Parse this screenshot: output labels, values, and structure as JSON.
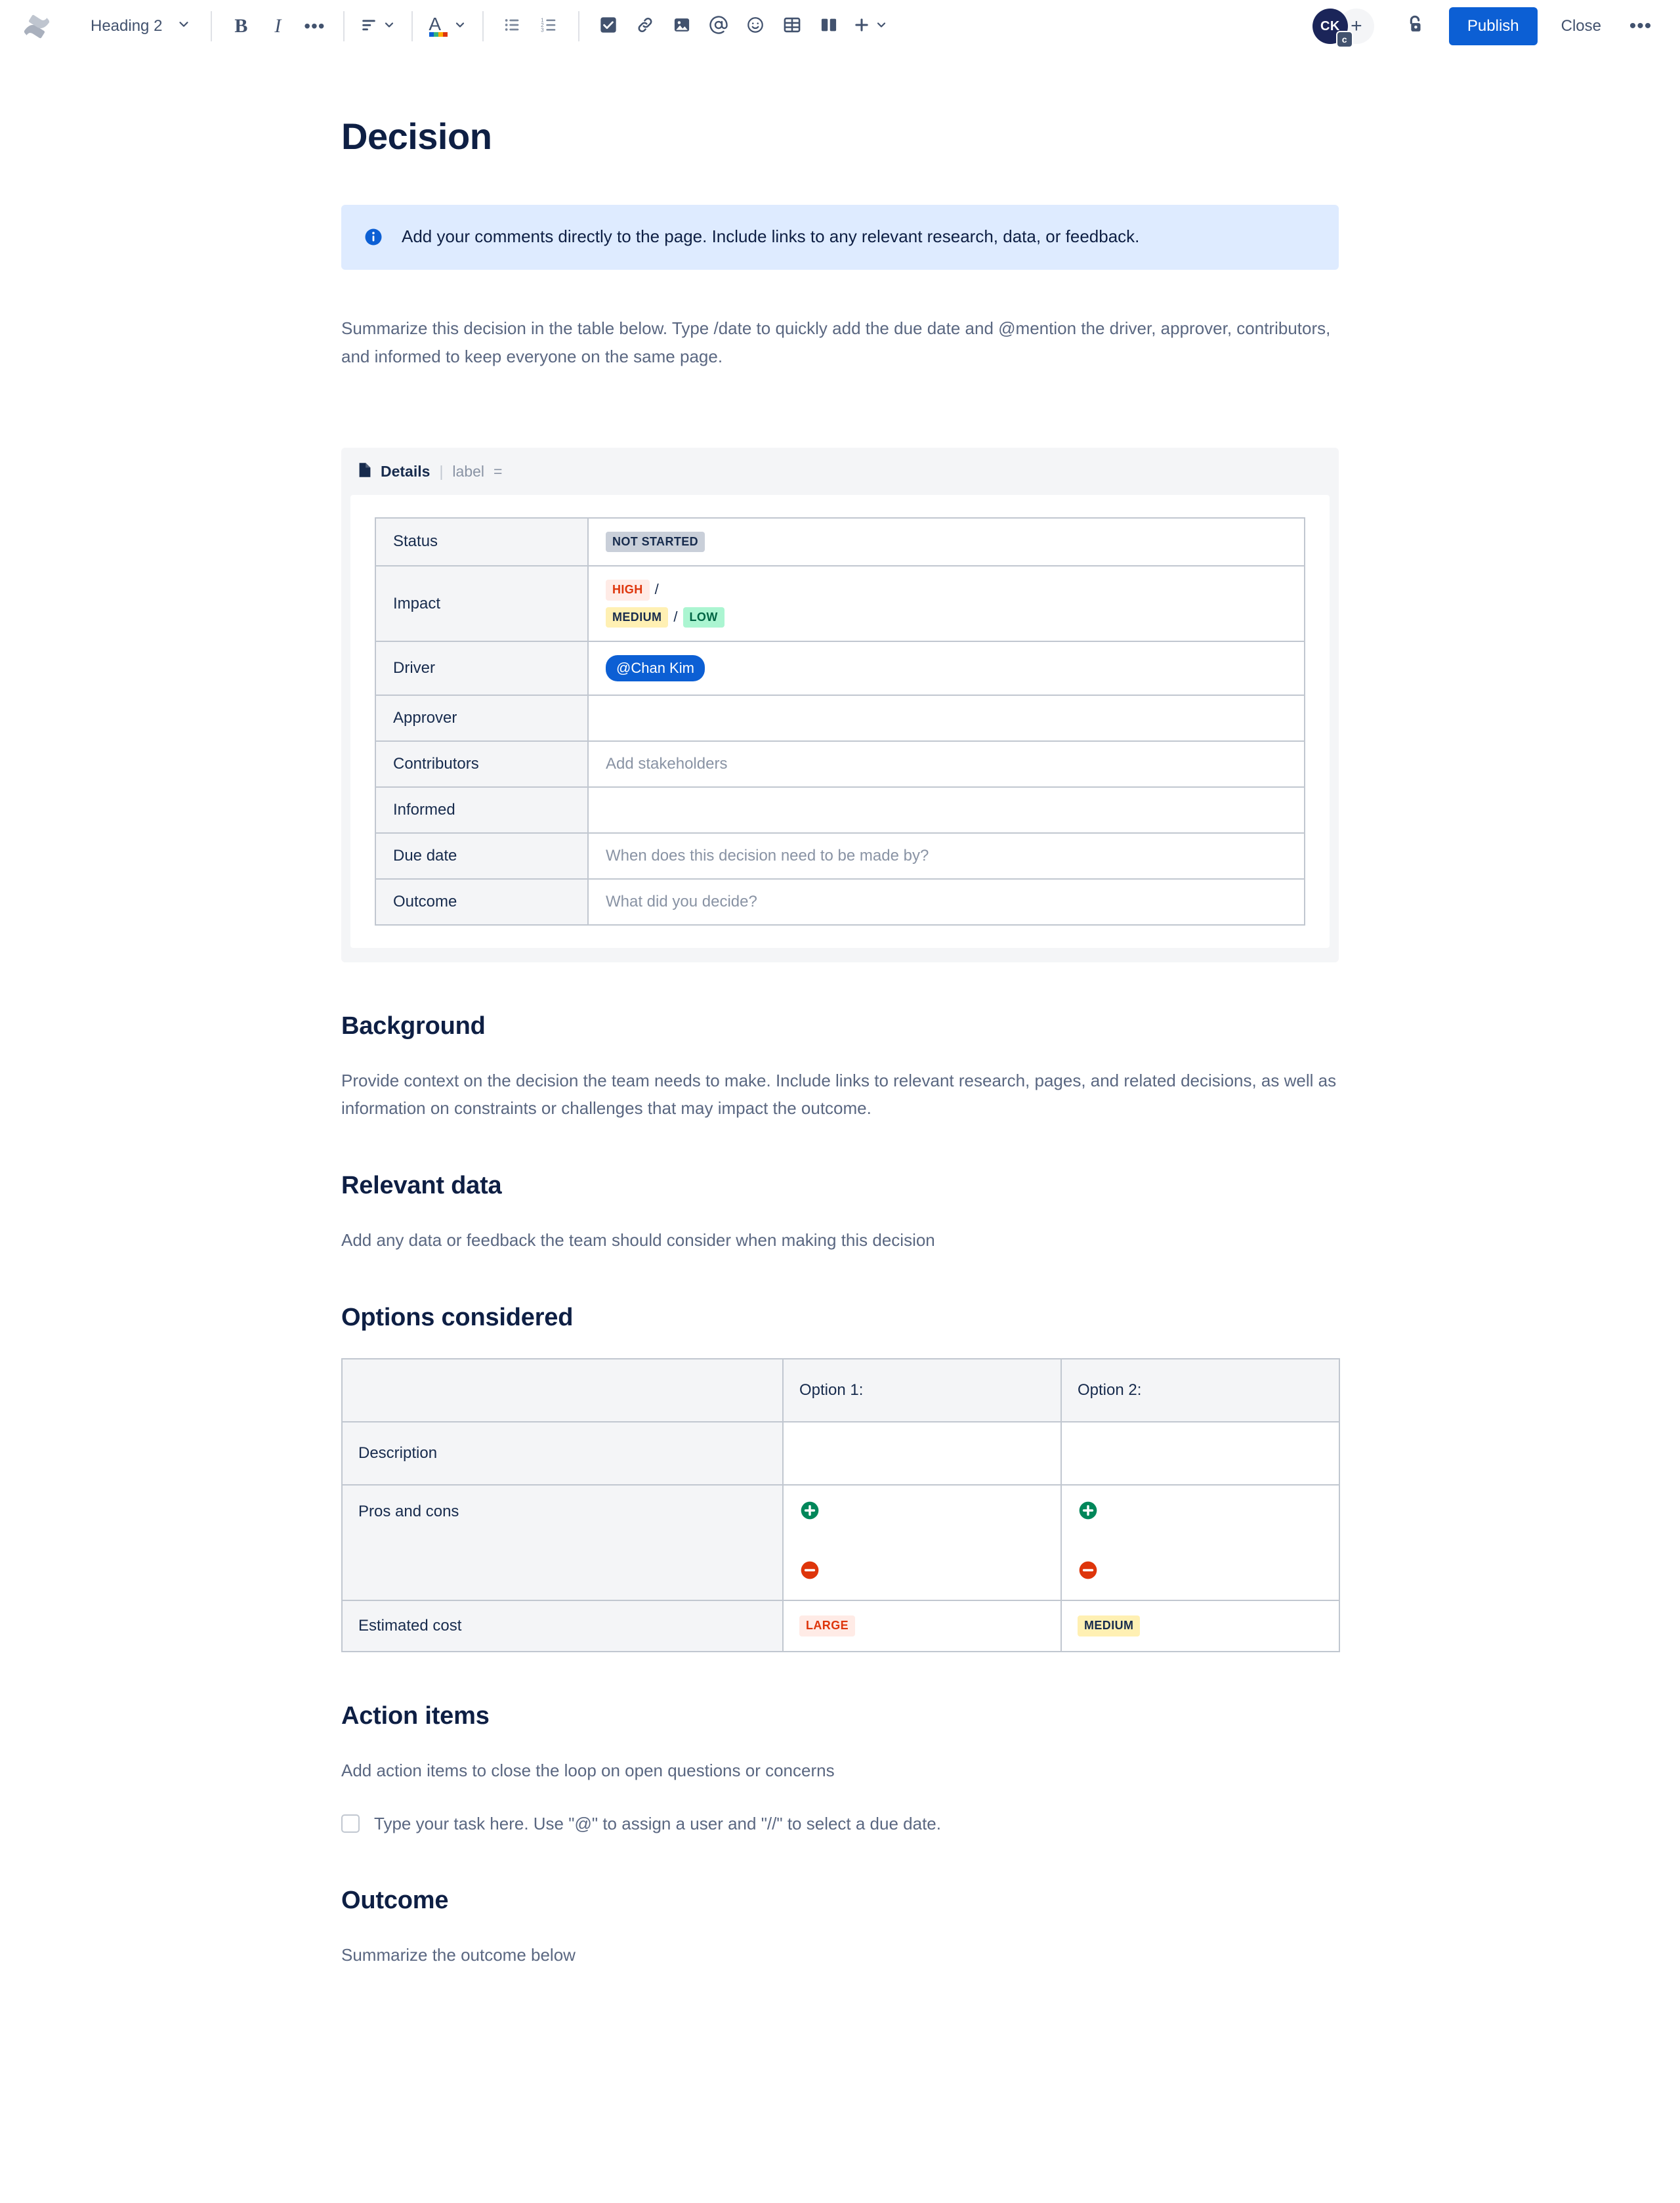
{
  "toolbar": {
    "logo_name": "confluence-logo",
    "style_select": {
      "label": "Heading 2"
    },
    "buttons": [
      {
        "name": "bold-button",
        "icon": "bold-icon",
        "label": "B"
      },
      {
        "name": "italic-button",
        "icon": "italic-icon",
        "label": "I"
      },
      {
        "name": "more-formatting-button",
        "icon": "ellipsis-icon",
        "label": "•••"
      },
      {
        "name": "text-align-button",
        "icon": "align-left-icon",
        "label": ""
      },
      {
        "name": "text-color-button",
        "icon": "text-color-icon",
        "label": "A"
      },
      {
        "name": "bullet-list-button",
        "icon": "bullet-list-icon",
        "label": ""
      },
      {
        "name": "numbered-list-button",
        "icon": "numbered-list-icon",
        "label": ""
      },
      {
        "name": "task-list-button",
        "icon": "checkbox-icon",
        "label": ""
      },
      {
        "name": "link-button",
        "icon": "link-icon",
        "label": ""
      },
      {
        "name": "image-button",
        "icon": "image-icon",
        "label": ""
      },
      {
        "name": "mention-button",
        "icon": "at-mention-icon",
        "label": "@"
      },
      {
        "name": "emoji-button",
        "icon": "emoji-icon",
        "label": ""
      },
      {
        "name": "table-button",
        "icon": "table-icon",
        "label": ""
      },
      {
        "name": "layout-button",
        "icon": "layout-columns-icon",
        "label": ""
      },
      {
        "name": "insert-more-button",
        "icon": "plus-icon",
        "label": "+"
      }
    ],
    "avatar": {
      "initials": "CK",
      "badge": "c"
    },
    "add_people_label": "+",
    "restrictions_icon": "unlocked-padlock-icon",
    "publish_label": "Publish",
    "close_label": "Close",
    "more_label": "•••"
  },
  "page": {
    "title": "Decision",
    "info_panel": {
      "icon": "info-icon",
      "text": "Add your comments directly to the page. Include links to any relevant research, data, or feedback."
    },
    "intro": "Summarize this decision in the table below. Type /date to quickly add the due date and @mention the driver, approver, contributors, and informed to keep everyone on the same page."
  },
  "details_macro": {
    "icon": "page-icon",
    "title": "Details",
    "pipe": "|",
    "label_key": "label",
    "label_eq": "=",
    "rows": [
      {
        "key": "Status",
        "type": "lozenge",
        "value": "NOT STARTED",
        "tone": "default"
      },
      {
        "key": "Impact",
        "type": "impact",
        "line1": [
          {
            "text": "HIGH",
            "tone": "red"
          }
        ],
        "line2": [
          {
            "text": "MEDIUM",
            "tone": "yellow"
          },
          {
            "text": "LOW",
            "tone": "green"
          }
        ],
        "separator": "/"
      },
      {
        "key": "Driver",
        "type": "mention",
        "value": "@Chan Kim"
      },
      {
        "key": "Approver",
        "type": "empty",
        "value": ""
      },
      {
        "key": "Contributors",
        "type": "placeholder",
        "value": "Add stakeholders"
      },
      {
        "key": "Informed",
        "type": "empty",
        "value": ""
      },
      {
        "key": "Due date",
        "type": "placeholder",
        "value": "When does this decision need to be made by?"
      },
      {
        "key": "Outcome",
        "type": "placeholder",
        "value": "What did you decide?"
      }
    ]
  },
  "sections": {
    "background": {
      "heading": "Background",
      "body": "Provide context on the decision the team needs to make. Include links to relevant research, pages, and related decisions, as well as information on constraints or challenges that may impact the outcome."
    },
    "relevant_data": {
      "heading": "Relevant data",
      "body": "Add any data or feedback the team should consider when making this decision"
    },
    "options_considered": {
      "heading": "Options considered"
    },
    "action_items": {
      "heading": "Action items",
      "body": "Add action items to close the loop on open questions or concerns",
      "task_placeholder": "Type your task here. Use \"@\" to assign a user and \"//\" to select a due date."
    },
    "outcome": {
      "heading": "Outcome",
      "body": "Summarize the outcome below"
    }
  },
  "options_table": {
    "headers": [
      "",
      "Option 1:",
      "Option 2:"
    ],
    "rows": [
      {
        "label": "Description",
        "option1": "",
        "option2": ""
      },
      {
        "label": "Pros and cons",
        "option1": "",
        "option2": ""
      },
      {
        "label": "Estimated cost",
        "option1": "LARGE",
        "option2": "MEDIUM",
        "option1_tone": "red",
        "option2_tone": "yellow"
      }
    ],
    "pros_icon": "plus-circle-icon",
    "cons_icon": "minus-circle-icon"
  },
  "colors": {
    "accent_blue": "#0C5FD4",
    "info_panel_bg": "#DEEBFF",
    "heading": "#0E1F44",
    "body_text": "#5A6781",
    "panel_grey": "#F4F5F7",
    "border": "#C1C7D0",
    "lozenge_red_bg": "#FFEBE6",
    "lozenge_red_fg": "#DE350B",
    "lozenge_yellow_bg": "#FFF0B3",
    "lozenge_green_bg": "#ABF5D1",
    "lozenge_green_fg": "#006644",
    "pros_green": "#00875A",
    "cons_red": "#DE350B"
  }
}
